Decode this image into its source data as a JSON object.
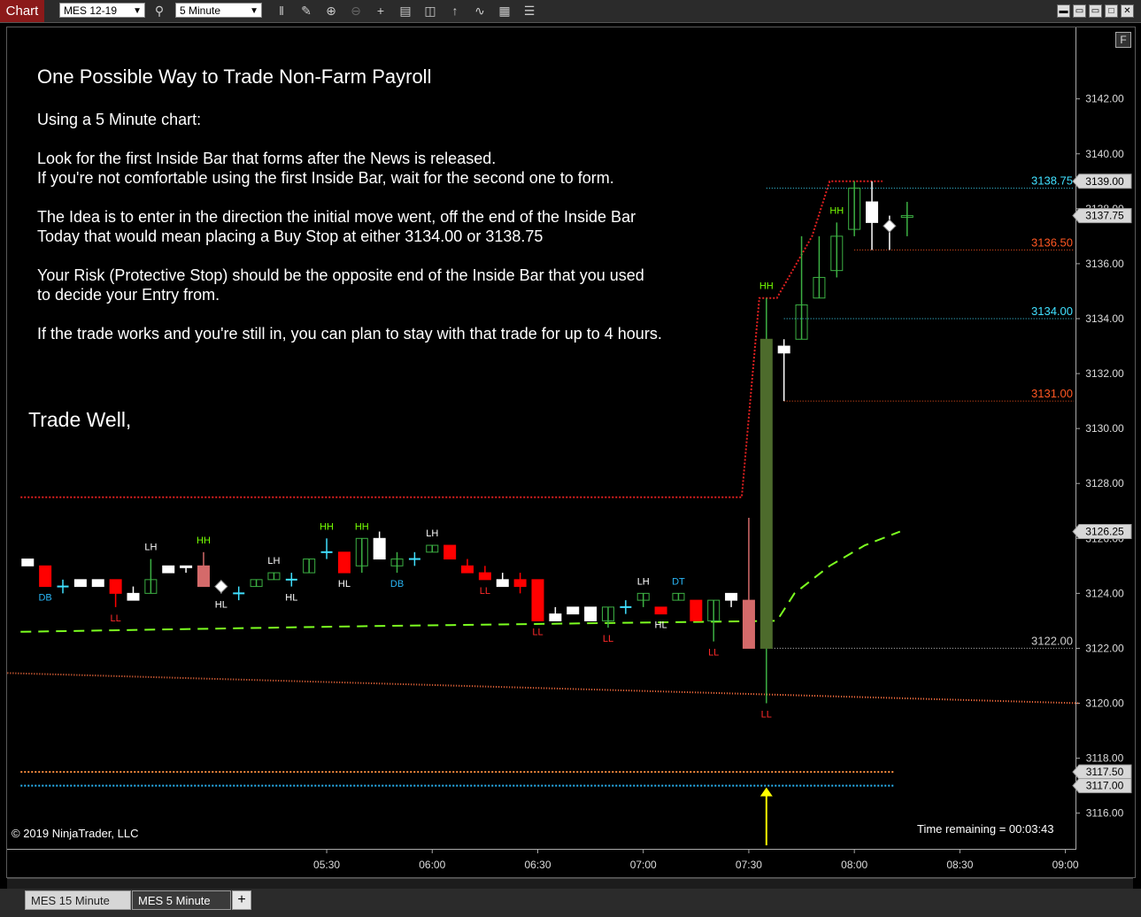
{
  "toolbar": {
    "chart_tab": "Chart",
    "instrument": "MES 12-19",
    "interval": "5 Minute",
    "icons": [
      "bars-type-icon",
      "draw-tool-icon",
      "zoom-in-icon",
      "zoom-out-icon",
      "crosshair-icon",
      "data-box-icon",
      "chart-trader-icon",
      "indicators-icon",
      "strategies-icon",
      "templates-icon",
      "properties-icon"
    ],
    "window_icons": [
      "minimize-icon",
      "restore-icon",
      "maximize-icon",
      "close-icon"
    ]
  },
  "annotation": {
    "title": "One Possible Way to Trade Non-Farm Payroll",
    "lines": [
      "Using a 5 Minute chart:",
      "Look for the first Inside Bar that forms after the News is released.",
      "If you're not comfortable using the first Inside Bar, wait for the second one to form.",
      "The Idea is to enter in the direction the initial move went, off the end of the Inside Bar",
      "Today that would mean placing a Buy Stop at either 3134.00 or 3138.75",
      "Your Risk (Protective Stop) should be the opposite end of the Inside Bar that you used",
      "to decide your Entry from.",
      "If the trade works and you're still in, you can plan to stay with that trade for up to 4 hours."
    ],
    "signoff": "Trade Well,"
  },
  "footer": {
    "copyright": "© 2019 NinjaTrader, LLC",
    "time_remaining": "Time remaining = 00:03:43"
  },
  "bottom_tabs": [
    "MES  15 Minute",
    "MES  5 Minute"
  ],
  "add_tab": "+",
  "f_button": "F",
  "chart_data": {
    "type": "candlestick",
    "instrument": "MES 12-19",
    "interval": "5 Minute",
    "ylim": [
      3114.7,
      3144.6
    ],
    "y_ticks": [
      "3142.00",
      "3140.00",
      "3138.00",
      "3136.00",
      "3134.00",
      "3132.00",
      "3130.00",
      "3128.00",
      "3126.00",
      "3124.00",
      "3122.00",
      "3120.00",
      "3118.00",
      "3116.00"
    ],
    "x_ticks": [
      {
        "label": "05:30",
        "bar": 18
      },
      {
        "label": "06:00",
        "bar": 24
      },
      {
        "label": "06:30",
        "bar": 30
      },
      {
        "label": "07:00",
        "bar": 36
      },
      {
        "label": "07:30",
        "bar": 42
      },
      {
        "label": "08:00",
        "bar": 48
      },
      {
        "label": "08:30",
        "bar": 54
      },
      {
        "label": "09:00",
        "bar": 60
      }
    ],
    "bars_first_index": 1,
    "bars": [
      {
        "o": 3125.25,
        "h": 3125.25,
        "l": 3125.0,
        "c": 3125.0,
        "col": "white"
      },
      {
        "o": 3125.0,
        "h": 3125.0,
        "l": 3124.25,
        "c": 3124.25,
        "col": "red"
      },
      {
        "o": 3124.25,
        "h": 3124.5,
        "l": 3124.0,
        "c": 3124.25,
        "col": "cyan"
      },
      {
        "o": 3124.25,
        "h": 3124.5,
        "l": 3124.25,
        "c": 3124.5,
        "col": "white"
      },
      {
        "o": 3124.5,
        "h": 3124.5,
        "l": 3124.25,
        "c": 3124.25,
        "col": "white"
      },
      {
        "o": 3124.5,
        "h": 3124.5,
        "l": 3123.5,
        "c": 3124.0,
        "col": "red"
      },
      {
        "o": 3124.0,
        "h": 3124.25,
        "l": 3123.75,
        "c": 3123.75,
        "col": "white"
      },
      {
        "o": 3124.0,
        "h": 3125.25,
        "l": 3124.0,
        "c": 3124.5,
        "col": "green"
      },
      {
        "o": 3124.75,
        "h": 3125.0,
        "l": 3124.75,
        "c": 3125.0,
        "col": "white"
      },
      {
        "o": 3125.0,
        "h": 3125.0,
        "l": 3124.75,
        "c": 3125.0,
        "col": "white"
      },
      {
        "o": 3124.25,
        "h": 3125.5,
        "l": 3124.25,
        "c": 3125.0,
        "col": "pink"
      },
      {
        "o": 3124.25,
        "h": 3124.25,
        "l": 3124.0,
        "c": 3124.25,
        "col": "diamond"
      },
      {
        "o": 3124.0,
        "h": 3124.25,
        "l": 3123.75,
        "c": 3124.0,
        "col": "cyan"
      },
      {
        "o": 3124.25,
        "h": 3124.5,
        "l": 3124.25,
        "c": 3124.5,
        "col": "green"
      },
      {
        "o": 3124.5,
        "h": 3124.75,
        "l": 3124.5,
        "c": 3124.75,
        "col": "green"
      },
      {
        "o": 3124.5,
        "h": 3124.75,
        "l": 3124.25,
        "c": 3124.5,
        "col": "cyan"
      },
      {
        "o": 3124.75,
        "h": 3125.25,
        "l": 3124.75,
        "c": 3125.25,
        "col": "green"
      },
      {
        "o": 3125.5,
        "h": 3126.0,
        "l": 3125.25,
        "c": 3125.5,
        "col": "cyan"
      },
      {
        "o": 3125.5,
        "h": 3125.5,
        "l": 3124.75,
        "c": 3124.75,
        "col": "red"
      },
      {
        "o": 3125.0,
        "h": 3126.0,
        "l": 3124.75,
        "c": 3126.0,
        "col": "green"
      },
      {
        "o": 3126.0,
        "h": 3126.25,
        "l": 3125.25,
        "c": 3125.25,
        "col": "white"
      },
      {
        "o": 3125.0,
        "h": 3125.5,
        "l": 3124.75,
        "c": 3125.25,
        "col": "green"
      },
      {
        "o": 3125.25,
        "h": 3125.5,
        "l": 3125.0,
        "c": 3125.25,
        "col": "cyan"
      },
      {
        "o": 3125.5,
        "h": 3125.75,
        "l": 3125.5,
        "c": 3125.75,
        "col": "green"
      },
      {
        "o": 3125.75,
        "h": 3125.75,
        "l": 3125.25,
        "c": 3125.25,
        "col": "red"
      },
      {
        "o": 3125.0,
        "h": 3125.25,
        "l": 3124.75,
        "c": 3124.75,
        "col": "red"
      },
      {
        "o": 3124.75,
        "h": 3125.0,
        "l": 3124.5,
        "c": 3124.5,
        "col": "red"
      },
      {
        "o": 3124.5,
        "h": 3124.75,
        "l": 3124.25,
        "c": 3124.25,
        "col": "white"
      },
      {
        "o": 3124.5,
        "h": 3124.75,
        "l": 3124.0,
        "c": 3124.25,
        "col": "red"
      },
      {
        "o": 3124.5,
        "h": 3124.5,
        "l": 3123.0,
        "c": 3123.0,
        "col": "red"
      },
      {
        "o": 3123.25,
        "h": 3123.5,
        "l": 3123.0,
        "c": 3123.0,
        "col": "white"
      },
      {
        "o": 3123.5,
        "h": 3123.5,
        "l": 3123.25,
        "c": 3123.25,
        "col": "white"
      },
      {
        "o": 3123.5,
        "h": 3123.5,
        "l": 3123.0,
        "c": 3123.0,
        "col": "white"
      },
      {
        "o": 3123.0,
        "h": 3123.5,
        "l": 3122.75,
        "c": 3123.5,
        "col": "green"
      },
      {
        "o": 3123.5,
        "h": 3123.75,
        "l": 3123.25,
        "c": 3123.5,
        "col": "cyan"
      },
      {
        "o": 3123.75,
        "h": 3124.0,
        "l": 3123.5,
        "c": 3124.0,
        "col": "green"
      },
      {
        "o": 3123.5,
        "h": 3123.5,
        "l": 3123.25,
        "c": 3123.25,
        "col": "red"
      },
      {
        "o": 3123.75,
        "h": 3124.0,
        "l": 3123.75,
        "c": 3124.0,
        "col": "green"
      },
      {
        "o": 3123.75,
        "h": 3123.75,
        "l": 3123.0,
        "c": 3123.0,
        "col": "red"
      },
      {
        "o": 3123.0,
        "h": 3123.75,
        "l": 3122.25,
        "c": 3123.75,
        "col": "green"
      },
      {
        "o": 3124.0,
        "h": 3124.0,
        "l": 3123.5,
        "c": 3123.75,
        "col": "white"
      },
      {
        "o": 3123.75,
        "h": 3126.75,
        "l": 3122.0,
        "c": 3122.0,
        "col": "pink"
      },
      {
        "o": 3122.0,
        "h": 3134.75,
        "l": 3120.0,
        "c": 3133.25,
        "col": "olive"
      },
      {
        "o": 3133.0,
        "h": 3133.25,
        "l": 3131.0,
        "c": 3132.75,
        "col": "white"
      },
      {
        "o": 3133.25,
        "h": 3137.0,
        "l": 3133.25,
        "c": 3134.5,
        "col": "green"
      },
      {
        "o": 3134.75,
        "h": 3137.0,
        "l": 3134.75,
        "c": 3135.5,
        "col": "green"
      },
      {
        "o": 3135.75,
        "h": 3137.5,
        "l": 3135.5,
        "c": 3137.0,
        "col": "green"
      },
      {
        "o": 3138.75,
        "h": 3139.0,
        "l": 3137.0,
        "c": 3137.25,
        "col": "green"
      },
      {
        "o": 3138.25,
        "h": 3139.0,
        "l": 3136.5,
        "c": 3137.5,
        "col": "white"
      },
      {
        "o": 3137.5,
        "h": 3137.75,
        "l": 3136.5,
        "c": 3137.25,
        "col": "diamond"
      },
      {
        "o": 3137.75,
        "h": 3138.25,
        "l": 3137.0,
        "c": 3137.75,
        "col": "green"
      }
    ],
    "swing_labels": [
      {
        "bar": 2,
        "text": "DB",
        "color": "#29b6f6",
        "pos": "below"
      },
      {
        "bar": 6,
        "text": "LL",
        "color": "#ff2a2a",
        "pos": "below"
      },
      {
        "bar": 8,
        "text": "LH",
        "color": "#ffffff",
        "pos": "above"
      },
      {
        "bar": 11,
        "text": "HH",
        "color": "#76ff03",
        "pos": "above"
      },
      {
        "bar": 12,
        "text": "HL",
        "color": "#ffffff",
        "pos": "below"
      },
      {
        "bar": 15,
        "text": "LH",
        "color": "#ffffff",
        "pos": "above"
      },
      {
        "bar": 16,
        "text": "HL",
        "color": "#ffffff",
        "pos": "below"
      },
      {
        "bar": 18,
        "text": "HH",
        "color": "#76ff03",
        "pos": "above"
      },
      {
        "bar": 19,
        "text": "HL",
        "color": "#ffffff",
        "pos": "below"
      },
      {
        "bar": 20,
        "text": "HH",
        "color": "#76ff03",
        "pos": "above"
      },
      {
        "bar": 22,
        "text": "DB",
        "color": "#29b6f6",
        "pos": "below"
      },
      {
        "bar": 24,
        "text": "LH",
        "color": "#ffffff",
        "pos": "above"
      },
      {
        "bar": 27,
        "text": "LL",
        "color": "#ff2a2a",
        "pos": "below"
      },
      {
        "bar": 30,
        "text": "LL",
        "color": "#ff2a2a",
        "pos": "below"
      },
      {
        "bar": 34,
        "text": "LL",
        "color": "#ff2a2a",
        "pos": "below"
      },
      {
        "bar": 36,
        "text": "LH",
        "color": "#ffffff",
        "pos": "above"
      },
      {
        "bar": 37,
        "text": "HL",
        "color": "#ffffff",
        "pos": "below"
      },
      {
        "bar": 38,
        "text": "DT",
        "color": "#29b6f6",
        "pos": "above"
      },
      {
        "bar": 40,
        "text": "LL",
        "color": "#ff2a2a",
        "pos": "below"
      },
      {
        "bar": 43,
        "text": "LL",
        "color": "#ff2a2a",
        "pos": "below"
      },
      {
        "bar": 43,
        "text": "HH",
        "color": "#76ff03",
        "pos": "above"
      },
      {
        "bar": 47,
        "text": "HH",
        "color": "#76ff03",
        "pos": "above"
      }
    ],
    "level_lines": [
      {
        "from_bar": 43,
        "price": 3138.75,
        "label": "3138.75",
        "color": "#40e0ff",
        "style": "dotted"
      },
      {
        "from_bar": 48,
        "price": 3136.5,
        "label": "3136.50",
        "color": "#ff5722",
        "style": "dotted"
      },
      {
        "from_bar": 44,
        "price": 3134.0,
        "label": "3134.00",
        "color": "#40e0ff",
        "style": "dotted"
      },
      {
        "from_bar": 44,
        "price": 3131.0,
        "label": "3131.00",
        "color": "#ff5722",
        "style": "dotted"
      },
      {
        "from_bar": 43,
        "price": 3122.0,
        "label": "3122.00",
        "color": "#cccccc",
        "style": "dotted"
      }
    ],
    "scale_markers": [
      {
        "price": 3139.0,
        "label": "3139.00"
      },
      {
        "price": 3137.75,
        "label": "3137.75"
      },
      {
        "price": 3126.25,
        "label": "3126.25"
      },
      {
        "price": 3117.5,
        "label": "3117.50"
      },
      {
        "price": 3117.0,
        "label": "3117.00"
      }
    ],
    "red_step_line": [
      [
        1,
        3127.5
      ],
      [
        42,
        3127.5
      ],
      [
        43,
        3134.75
      ],
      [
        44,
        3134.75
      ],
      [
        46,
        3137.0
      ],
      [
        47,
        3139.0
      ],
      [
        50,
        3139.0
      ]
    ],
    "green_dashed_line": [
      [
        1,
        3122.6
      ],
      [
        20,
        3122.8
      ],
      [
        44,
        3123.0
      ],
      [
        45,
        3124.0
      ],
      [
        47,
        3125.0
      ],
      [
        49,
        3125.75
      ],
      [
        51,
        3126.25
      ]
    ],
    "orange_trend_line": {
      "from": [
        0,
        3121.1
      ],
      "to": [
        61,
        3120.0
      ]
    },
    "horizontal_lines": [
      {
        "price": 3117.5,
        "color": "#ff9040",
        "from_bar": 1,
        "to_bar": 50
      },
      {
        "price": 3117.0,
        "color": "#29b6f6",
        "from_bar": 1,
        "to_bar": 50
      }
    ],
    "arrow": {
      "bar": 43,
      "price": 3117.0,
      "color": "#ffff00"
    }
  }
}
